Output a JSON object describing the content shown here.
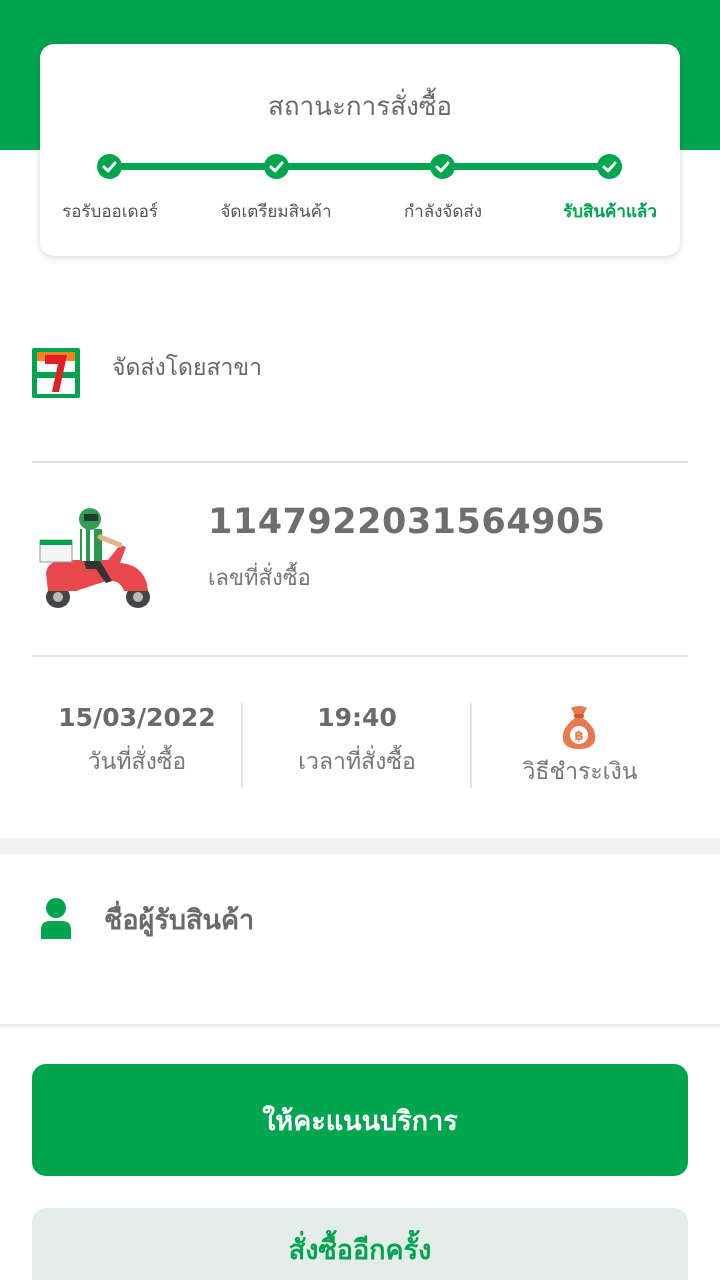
{
  "status_card": {
    "title": "สถานะการสั่งซื้อ",
    "steps": [
      {
        "label": "รอรับออเดอร์",
        "done": true
      },
      {
        "label": "จัดเตรียมสินค้า",
        "done": true
      },
      {
        "label": "กำลังจัดส่ง",
        "done": true
      },
      {
        "label": "รับสินค้าแล้ว",
        "done": true
      }
    ]
  },
  "branch": {
    "label": "จัดส่งโดยสาขา"
  },
  "order": {
    "number": "1147922031564905",
    "number_label": "เลขที่สั่งซื้อ"
  },
  "info": {
    "date": "15/03/2022",
    "date_label": "วันที่สั่งซื้อ",
    "time": "19:40",
    "time_label": "เวลาที่สั่งซื้อ",
    "payment_label": "วิธีชำระเงิน"
  },
  "receiver": {
    "label": "ชื่อผู้รับสินค้า"
  },
  "buttons": {
    "rate": "ให้คะแนนบริการ",
    "reorder": "สั่งซื้ออีกครั้ง"
  },
  "colors": {
    "brand_green": "#00a550",
    "accent_orange": "#e97a4f"
  }
}
